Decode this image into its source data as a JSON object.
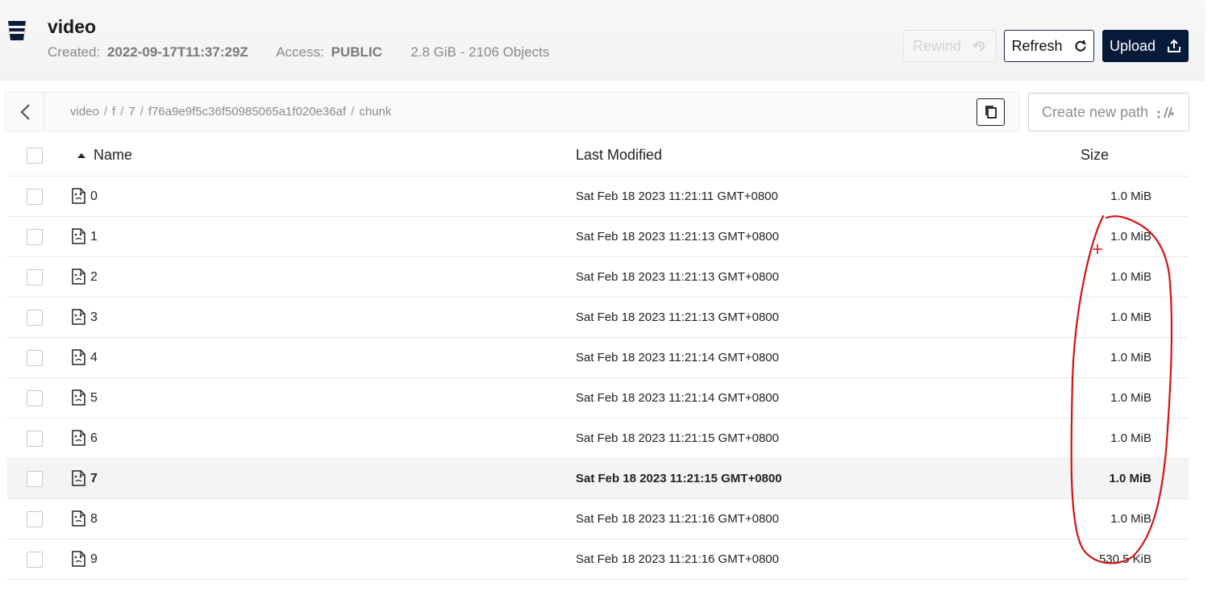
{
  "bucket": {
    "name": "video",
    "created_label": "Created:",
    "created_value": "2022-09-17T11:37:29Z",
    "access_label": "Access:",
    "access_value": "PUBLIC",
    "usage": "2.8 GiB - 2106 Objects"
  },
  "toolbar": {
    "rewind_label": "Rewind",
    "refresh_label": "Refresh",
    "upload_label": "Upload",
    "create_path_label": "Create new path"
  },
  "breadcrumb": [
    "video",
    "f",
    "7",
    "f76a9e9f5c36f50985065a1f020e36af",
    "chunk"
  ],
  "table": {
    "columns": {
      "name": "Name",
      "modified": "Last Modified",
      "size": "Size"
    },
    "sort_column": "Name",
    "sort_direction": "ascending",
    "rows": [
      {
        "name": "0",
        "modified": "Sat Feb 18 2023 11:21:11 GMT+0800",
        "size": "1.0 MiB"
      },
      {
        "name": "1",
        "modified": "Sat Feb 18 2023 11:21:13 GMT+0800",
        "size": "1.0 MiB"
      },
      {
        "name": "2",
        "modified": "Sat Feb 18 2023 11:21:13 GMT+0800",
        "size": "1.0 MiB"
      },
      {
        "name": "3",
        "modified": "Sat Feb 18 2023 11:21:13 GMT+0800",
        "size": "1.0 MiB"
      },
      {
        "name": "4",
        "modified": "Sat Feb 18 2023 11:21:14 GMT+0800",
        "size": "1.0 MiB"
      },
      {
        "name": "5",
        "modified": "Sat Feb 18 2023 11:21:14 GMT+0800",
        "size": "1.0 MiB"
      },
      {
        "name": "6",
        "modified": "Sat Feb 18 2023 11:21:15 GMT+0800",
        "size": "1.0 MiB"
      },
      {
        "name": "7",
        "modified": "Sat Feb 18 2023 11:21:15 GMT+0800",
        "size": "1.0 MiB",
        "highlighted": true
      },
      {
        "name": "8",
        "modified": "Sat Feb 18 2023 11:21:16 GMT+0800",
        "size": "1.0 MiB"
      },
      {
        "name": "9",
        "modified": "Sat Feb 18 2023 11:21:16 GMT+0800",
        "size": "530.5 KiB"
      }
    ]
  },
  "icons": {
    "bucket": "bucket-icon",
    "rewind": "history-icon",
    "refresh": "refresh-icon",
    "upload": "upload-icon",
    "back": "chevron-left-icon",
    "copy": "copy-icon",
    "new_path": "new-path-icon",
    "sort": "sort-ascending-icon",
    "file": "file-icon"
  },
  "colors": {
    "primary": "#081a3a",
    "annotation": "#d21414",
    "disabled": "#d4d4d4"
  }
}
